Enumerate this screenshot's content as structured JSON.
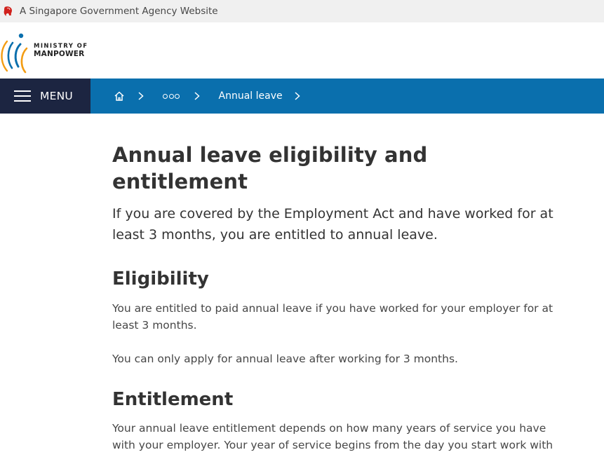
{
  "gov_bar": {
    "text": "A Singapore Government Agency Website",
    "icon": "lion-head-icon",
    "icon_color": "#d0211c"
  },
  "logo": {
    "line1": "MINISTRY OF",
    "line2": "MANPOWER"
  },
  "nav": {
    "menu_label": "MENU",
    "menu_bg": "#1c2541",
    "bar_bg": "#0a6fad",
    "home_icon": "home-icon",
    "breadcrumb_current": "Annual leave"
  },
  "article": {
    "title": "Annual leave eligibility and entitlement",
    "lead": "If you are covered by the Employment Act and have worked for at least 3 months, you are entitled to annual leave.",
    "sections": [
      {
        "heading": "Eligibility",
        "paragraphs": [
          "You are entitled to paid annual leave if you have worked for your employer for at least 3 months.",
          "You can only apply for annual leave after working for 3 months."
        ]
      },
      {
        "heading": "Entitlement",
        "paragraphs": [
          "Your annual leave entitlement depends on how many years of service you have with your employer. Your year of service begins from the day you start work with your employer."
        ]
      }
    ]
  }
}
